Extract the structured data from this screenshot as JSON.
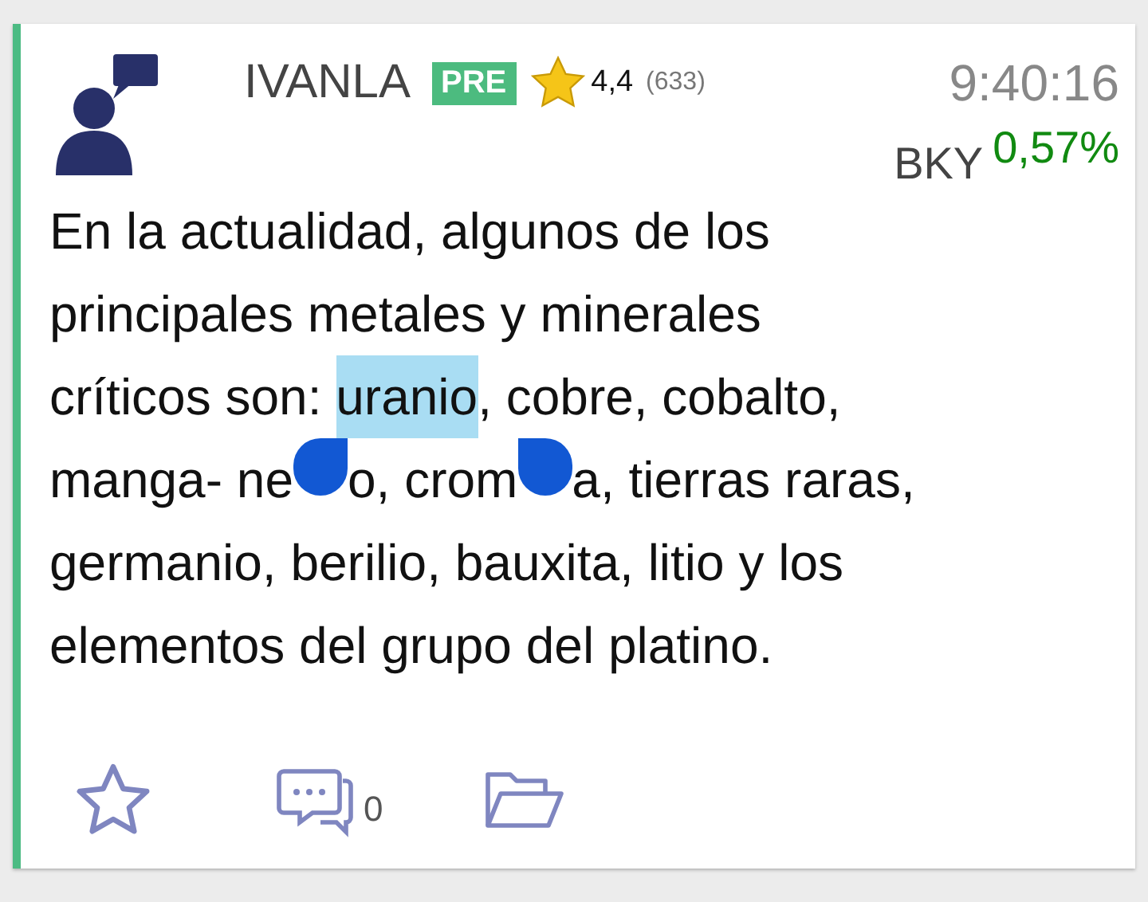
{
  "author": {
    "name": "IVANLA",
    "badge": "PRE",
    "rating": "4,4",
    "rating_count": "(633)"
  },
  "time": "9:40:16",
  "ticker": {
    "symbol": "BKY",
    "change": "0,57%"
  },
  "lines": [
    [
      {
        "kind": "text",
        "text": "En la actualidad, algunos de los"
      }
    ],
    [
      {
        "kind": "text",
        "text": "principales metales y minerales"
      }
    ],
    [
      {
        "kind": "text",
        "text": "críticos son: "
      },
      {
        "kind": "selected",
        "text": "uranio"
      },
      {
        "kind": "text",
        "text": ", cobre, cobalto,"
      }
    ],
    [
      {
        "kind": "text",
        "text": "manga- ne"
      },
      {
        "kind": "handle_left"
      },
      {
        "kind": "text",
        "text": "o, crom"
      },
      {
        "kind": "handle_right"
      },
      {
        "kind": "text",
        "text": "a, tierras raras,"
      }
    ],
    [
      {
        "kind": "text",
        "text": "germanio, berilio, bauxita, litio y los"
      }
    ],
    [
      {
        "kind": "text",
        "text": "elementos del grupo del platino."
      }
    ]
  ],
  "actions": {
    "comment_count": "0"
  }
}
